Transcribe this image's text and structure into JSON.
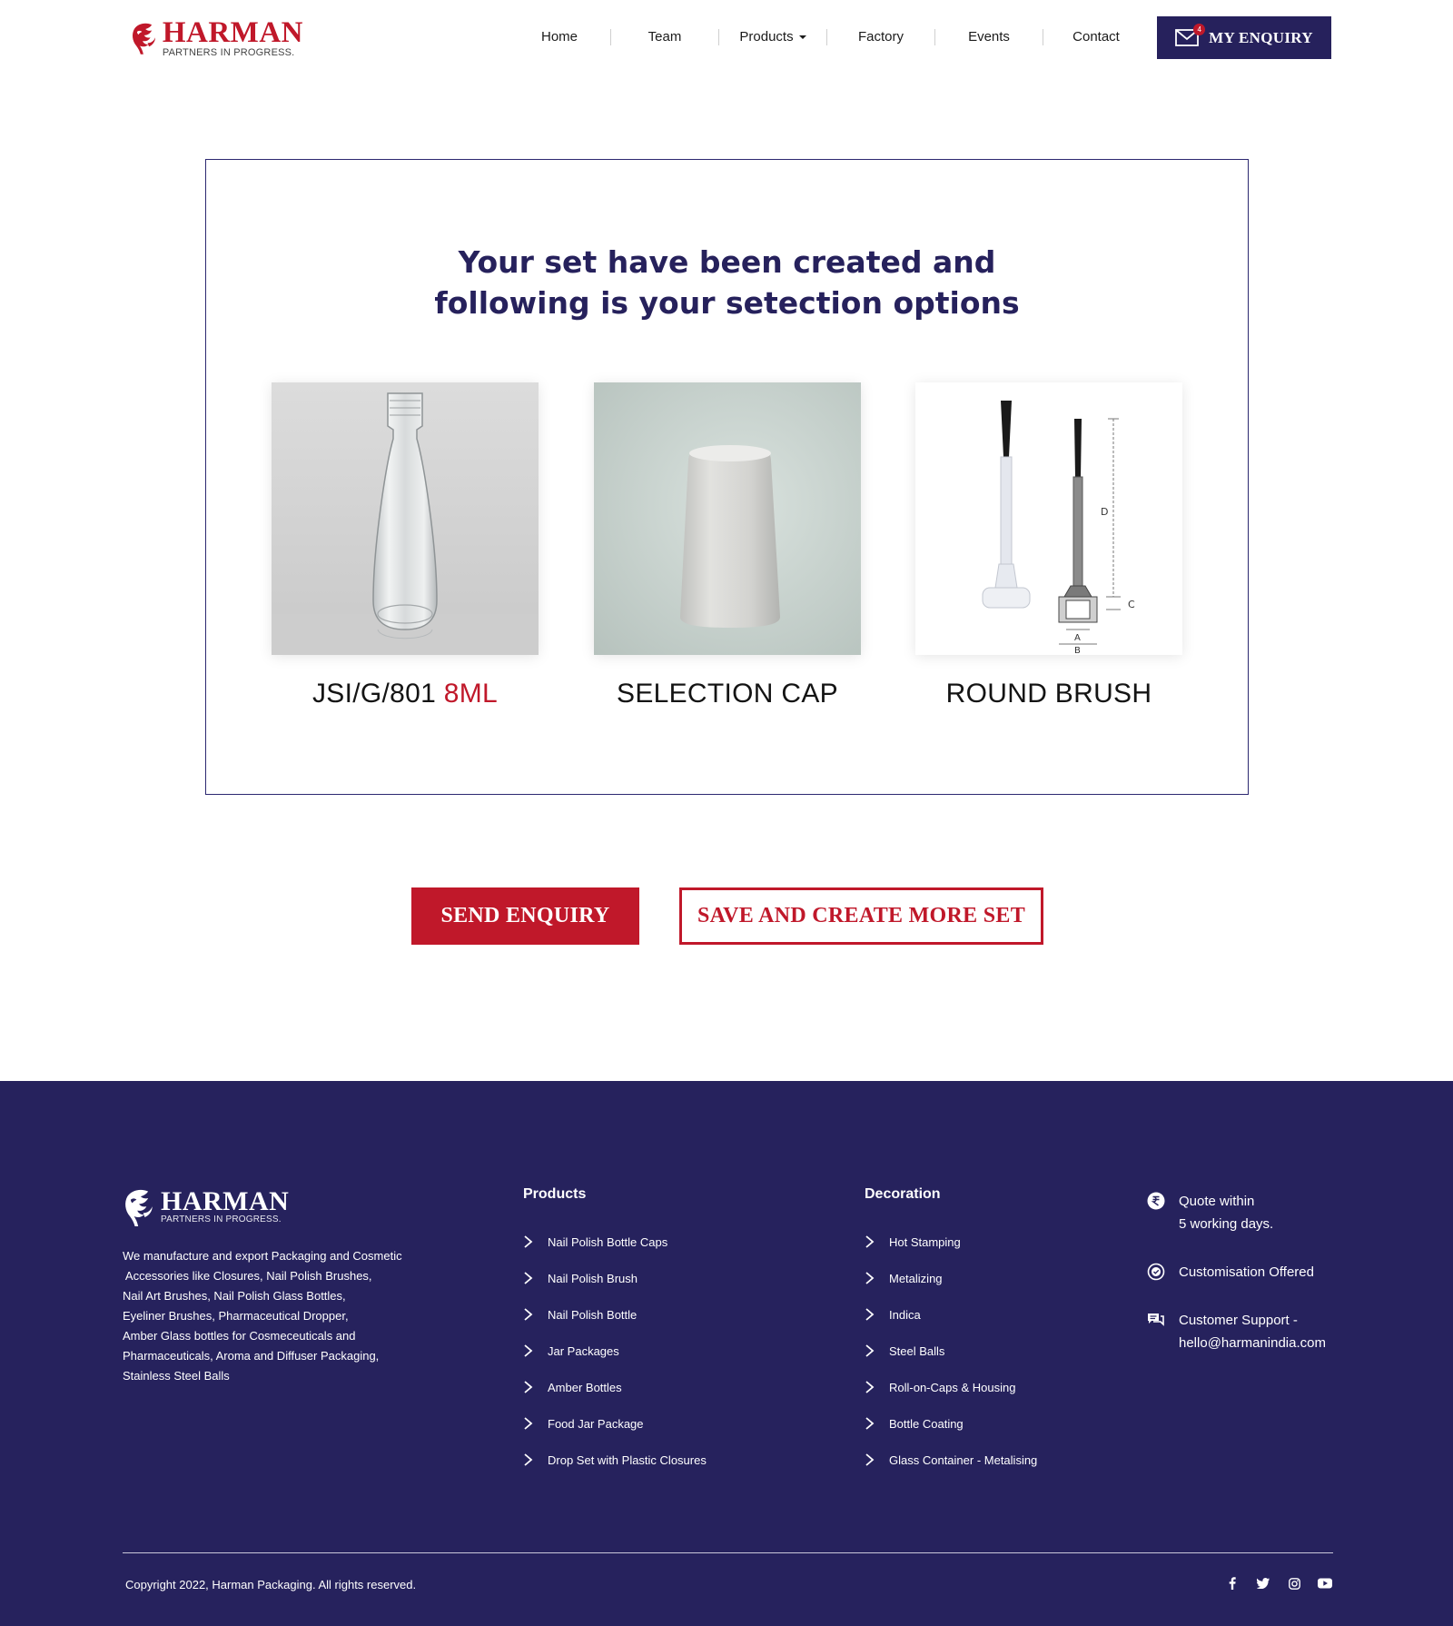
{
  "header": {
    "logo": {
      "name": "HARMAN",
      "tagline": "PARTNERS IN PROGRESS."
    },
    "nav": [
      {
        "label": "Home"
      },
      {
        "label": "Team"
      },
      {
        "label": "Products",
        "has_dropdown": true
      },
      {
        "label": "Factory"
      },
      {
        "label": "Events"
      },
      {
        "label": "Contact"
      }
    ],
    "enquiry_button": {
      "label": "MY ENQUIRY",
      "badge_count": "4",
      "icon": "envelope-icon"
    }
  },
  "selection": {
    "title_line1": "Your set have been created and",
    "title_line2": "following is your setection options",
    "items": [
      {
        "label": "JSI/G/801",
        "label_accent": "8ML",
        "image": "glass-bottle-image"
      },
      {
        "label": "SELECTION CAP",
        "label_accent": "",
        "image": "cap-image"
      },
      {
        "label": "ROUND BRUSH",
        "label_accent": "",
        "image": "brush-diagram-image",
        "diagram_labels": [
          "D",
          "C",
          "A",
          "B"
        ]
      }
    ]
  },
  "actions": {
    "send_label": "SEND ENQUIRY",
    "save_label": "SAVE AND CREATE MORE SET"
  },
  "footer": {
    "logo": {
      "name": "HARMAN",
      "tagline": "PARTNERS IN PROGRESS."
    },
    "about_lines": [
      "We manufacture and export Packaging and Cosmetic",
      " Accessories like Closures, Nail Polish Brushes,",
      "Nail Art Brushes, Nail Polish Glass Bottles,",
      "Eyeliner Brushes, Pharmaceutical Dropper,",
      "Amber Glass bottles for Cosmeceuticals and",
      "Pharmaceuticals, Aroma and Diffuser Packaging,",
      "Stainless Steel Balls"
    ],
    "products": {
      "heading": "Products",
      "links": [
        "Nail Polish Bottle Caps",
        "Nail Polish Brush",
        "Nail Polish Bottle",
        "Jar Packages",
        "Amber Bottles",
        "Food Jar Package",
        "Drop Set with Plastic Closures"
      ]
    },
    "decoration": {
      "heading": "Decoration",
      "links": [
        "Hot Stamping",
        "Metalizing",
        "Indica",
        "Steel Balls",
        "Roll-on-Caps & Housing",
        "Bottle Coating",
        "Glass Container - Metalising"
      ]
    },
    "info": [
      {
        "icon": "rupee-icon",
        "line1": "Quote within",
        "line2": "5 working days."
      },
      {
        "icon": "badge-icon",
        "line1": "Customisation Offered",
        "line2": ""
      },
      {
        "icon": "chat-icon",
        "line1": "Customer Support -",
        "line2": "hello@harmanindia.com"
      }
    ],
    "copyright": "Copyright 2022, Harman Packaging. All rights reserved.",
    "social": [
      "facebook-icon",
      "twitter-icon",
      "instagram-icon",
      "youtube-icon"
    ]
  },
  "colors": {
    "brand_red": "#c0182a",
    "brand_navy": "#26215c",
    "footer_bg": "#26225d"
  }
}
